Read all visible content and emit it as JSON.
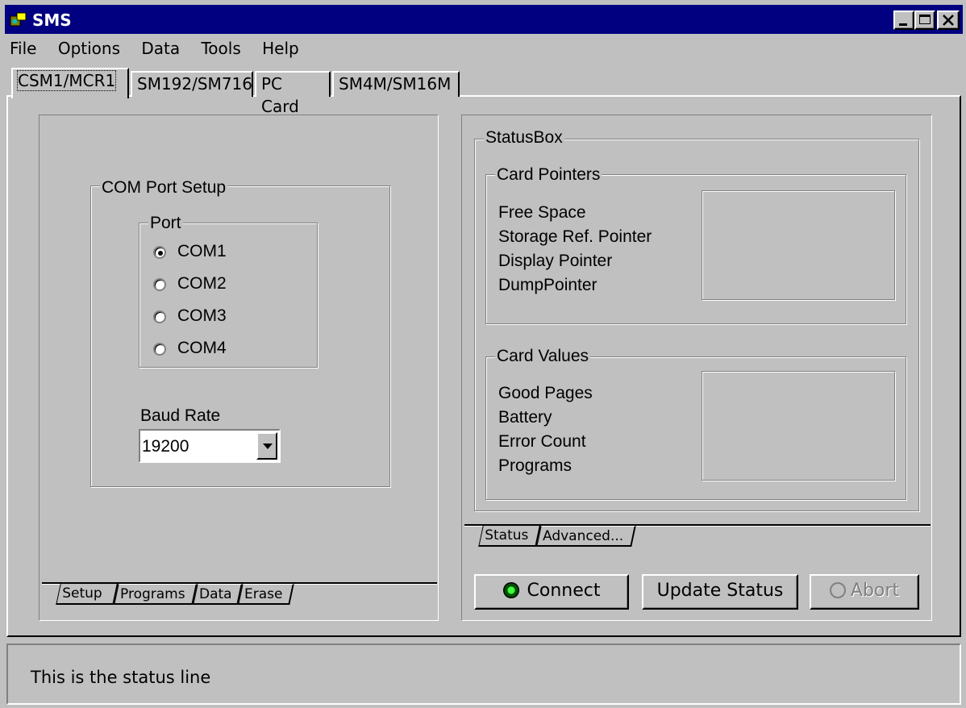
{
  "window": {
    "title": "SMS",
    "controls": [
      "minimize-icon",
      "maximize-icon",
      "close-icon"
    ]
  },
  "menu": [
    "File",
    "Options",
    "Data",
    "Tools",
    "Help"
  ],
  "device_tabs": [
    "CSM1/MCR1",
    "SM192/SM716",
    "PC Card",
    "SM4M/SM16M"
  ],
  "setup": {
    "com_group": "COM Port Setup",
    "port_group": "Port",
    "ports": [
      "COM1",
      "COM2",
      "COM3",
      "COM4"
    ],
    "selected_port": "COM1",
    "baud_label": "Baud Rate",
    "baud_value": "19200"
  },
  "left_tabs": [
    "Setup",
    "Programs",
    "Data",
    "Erase"
  ],
  "status_box": {
    "title": "StatusBox",
    "pointers_group": "Card Pointers",
    "pointers": [
      "Free Space",
      "Storage Ref. Pointer",
      "Display Pointer",
      "DumpPointer"
    ],
    "values_group": "Card Values",
    "values": [
      "Good Pages",
      "Battery",
      "Error Count",
      "Programs"
    ]
  },
  "right_tabs": [
    "Status",
    "Advanced..."
  ],
  "buttons": {
    "connect": "Connect",
    "update": "Update Status",
    "abort": "Abort"
  },
  "status_line": "This is the status line"
}
